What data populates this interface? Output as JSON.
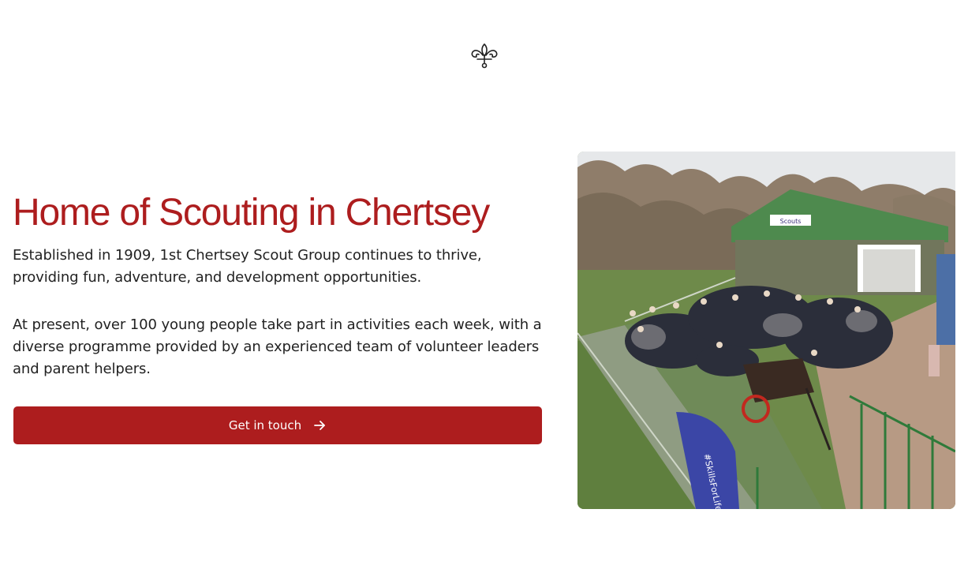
{
  "header": {
    "logo_icon": "fleur-de-lis-icon"
  },
  "hero": {
    "title": "Home of Scouting in Chertsey",
    "paragraph_1": "Established in 1909, 1st Chertsey Scout Group continues to thrive, providing fun, adventure, and development opportunities.",
    "paragraph_2": "At present, over 100 young people take part in activities each week, with a diverse programme provided by an experienced team of volunteer leaders and parent helpers.",
    "cta_label": "Get in touch",
    "cta_icon": "arrow-right-icon"
  },
  "photo": {
    "sign_text": "Scouts",
    "banner_text": "#SkillsForLife"
  },
  "colors": {
    "brand_red": "#ad1d1e",
    "text": "#222222",
    "background": "#ffffff"
  }
}
